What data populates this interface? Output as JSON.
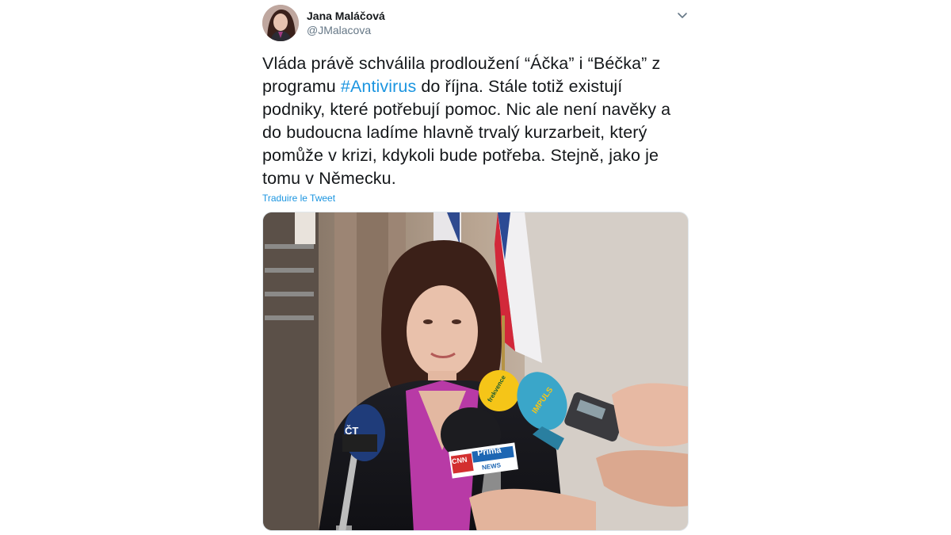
{
  "tweet": {
    "author": {
      "name": "Jana Maláčová",
      "handle": "@JMalacova"
    },
    "menu_icon": "chevron-down-icon",
    "text_lines": [
      [
        {
          "t": "Vláda právě schválila prodloužení “Áčka” i “Béčka” z"
        }
      ],
      [
        {
          "t": "programu "
        },
        {
          "h": "#Antivirus"
        },
        {
          "t": " do října. Stále totiž existují"
        }
      ],
      [
        {
          "t": "podniky, které potřebují pomoc. Nic ale není navěky a"
        }
      ],
      [
        {
          "t": "do budoucna ladíme hlavně trvalý kurzarbeit, který"
        }
      ],
      [
        {
          "t": "pomůže v krizi, kdykoli bude potřeba. Stejně, jako je"
        }
      ],
      [
        {
          "t": "tomu v Německu."
        }
      ]
    ],
    "translate_label": "Traduire le Tweet"
  },
  "photo": {
    "microphone_labels": {
      "ct": "ČT",
      "cnn": "CNN",
      "prima": "Prima",
      "news": "NEWS",
      "frekvence": "frekvence",
      "impuls": "IMPULS"
    }
  },
  "colors": {
    "link": "#1b95e0",
    "text": "#14171a",
    "secondary": "#657786"
  }
}
